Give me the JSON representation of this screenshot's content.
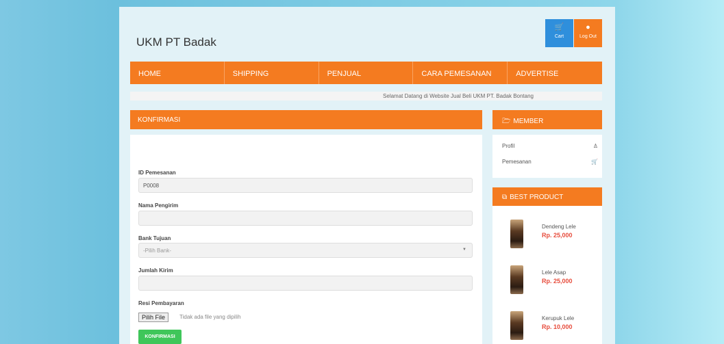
{
  "header": {
    "brand": "UKM PT Badak",
    "cart_label": "Cart",
    "logout_label": "Log Out"
  },
  "nav": {
    "items": [
      {
        "label": "HOME"
      },
      {
        "label": "SHIPPING"
      },
      {
        "label": "PENJUAL"
      },
      {
        "label": "CARA PEMESANAN"
      },
      {
        "label": "ADVERTISE"
      }
    ]
  },
  "welcome": "Selamat Datang di Website Jual Beli UKM PT. Badak Bontang",
  "form": {
    "title": "KONFIRMASI",
    "id_label": "ID Pemesanan",
    "id_value": "P0008",
    "sender_label": "Nama Pengirim",
    "sender_value": "",
    "bank_label": "Bank Tujuan",
    "bank_selected": "-Pilih Bank-",
    "amount_label": "Jumlah Kirim",
    "amount_value": "",
    "receipt_label": "Resi Pembayaran",
    "file_button": "Pilih File",
    "file_status": "Tidak ada file yang dipilih",
    "submit_label": "KONFIRMASI"
  },
  "member": {
    "title": "MEMBER",
    "items": [
      {
        "label": "Profil",
        "icon": "person-icon"
      },
      {
        "label": "Pemesanan",
        "icon": "cart-icon"
      }
    ]
  },
  "products": {
    "title": "BEST PRODUCT",
    "items": [
      {
        "name": "Dendeng Lele",
        "price": "Rp. 25,000"
      },
      {
        "name": "Lele Asap",
        "price": "Rp. 25,000"
      },
      {
        "name": "Kerupuk Lele",
        "price": "Rp. 10,000"
      }
    ]
  },
  "colors": {
    "accent": "#f47b20",
    "cart_button": "#2f8fdc",
    "submit_button": "#3fc65a",
    "price": "#e74c3c"
  }
}
